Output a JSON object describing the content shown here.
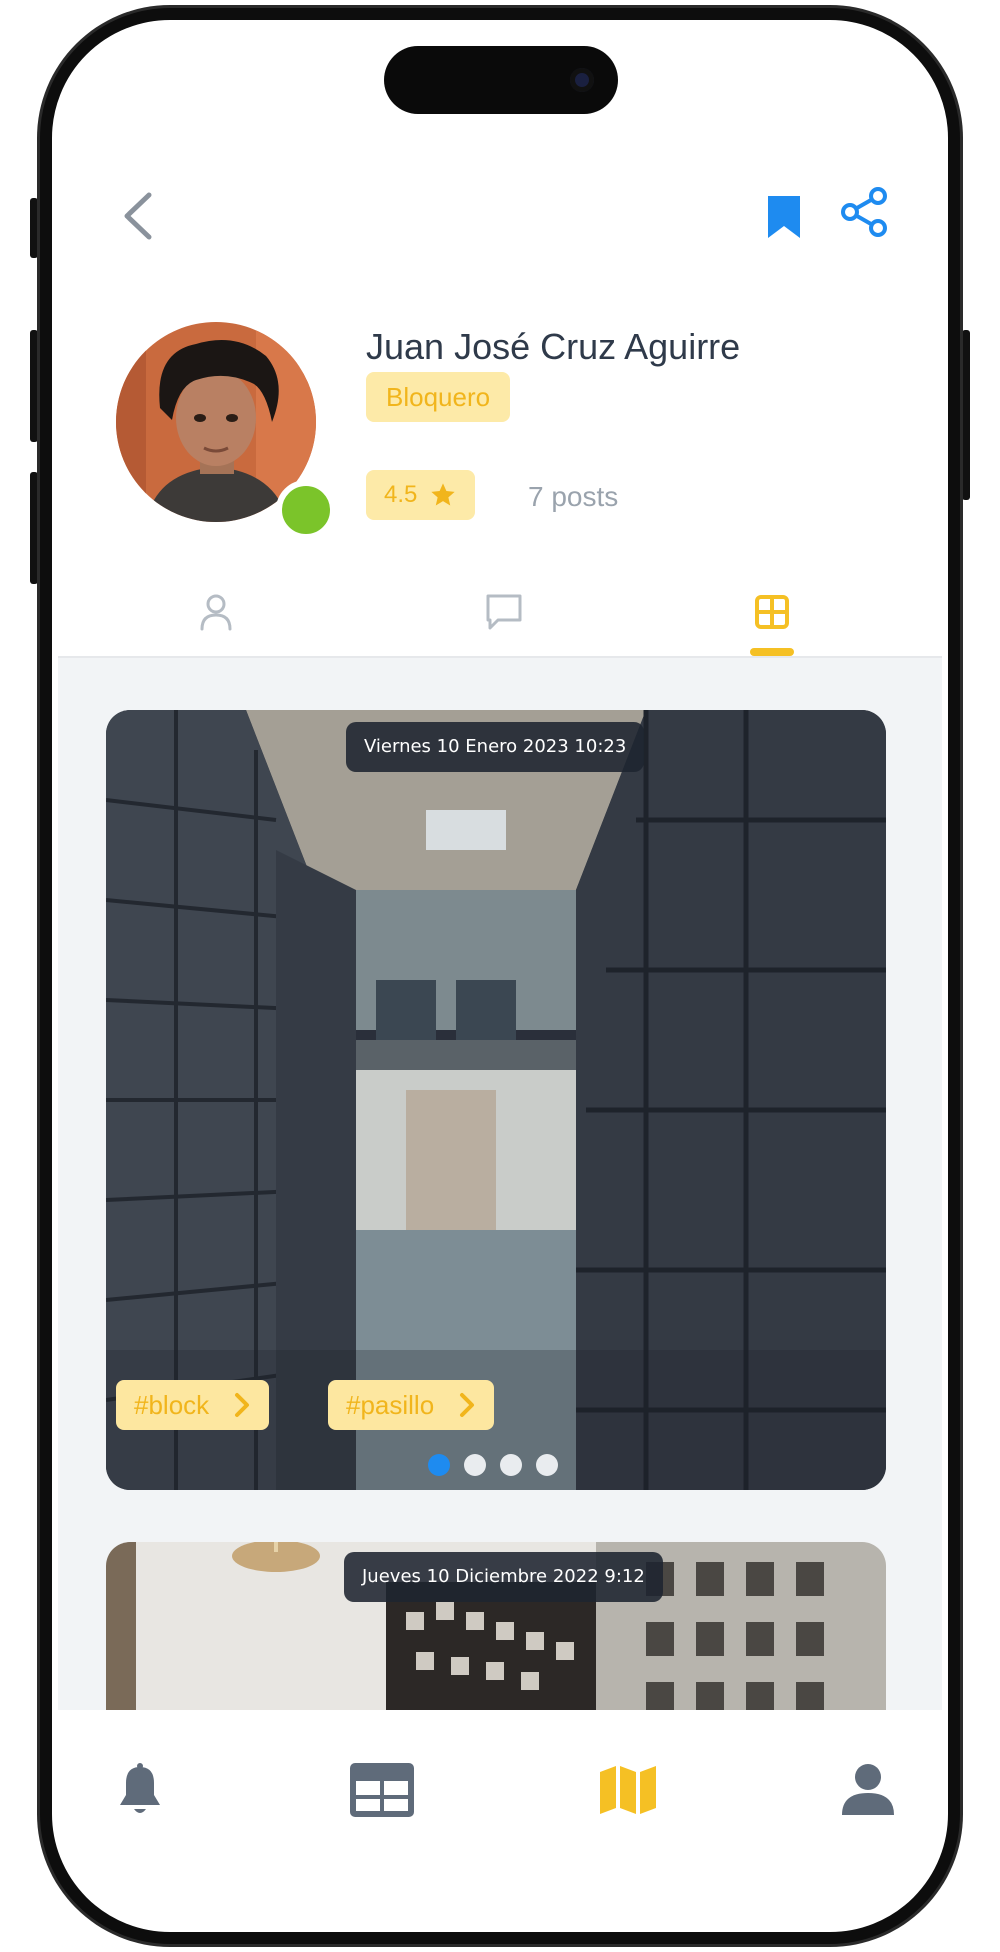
{
  "profile": {
    "name": "Juan José Cruz Aguirre",
    "role": "Bloquero",
    "rating": "4.5",
    "posts": "7 posts",
    "online": true
  },
  "tabs": [
    {
      "id": "profile",
      "icon": "person-icon",
      "active": false
    },
    {
      "id": "comments",
      "icon": "chat-bubble-icon",
      "active": false
    },
    {
      "id": "grid",
      "icon": "grid-icon",
      "active": true
    }
  ],
  "posts": [
    {
      "date": "Viernes 10 Enero 2023 10:23",
      "tags": [
        "#block",
        "#pasillo"
      ],
      "carousel_count": 4,
      "carousel_active": 1
    },
    {
      "date": "Jueves 10 Diciembre 2022 9:12"
    }
  ],
  "bottom_nav": [
    {
      "id": "notifications",
      "icon": "bell-icon",
      "active": false
    },
    {
      "id": "feed",
      "icon": "layout-grid-icon",
      "active": false
    },
    {
      "id": "map",
      "icon": "map-icon",
      "active": true
    },
    {
      "id": "account",
      "icon": "user-icon",
      "active": false
    }
  ],
  "colors": {
    "accent": "#f5c024",
    "badge_bg": "#fdeaa8",
    "blue": "#1e8bf0",
    "online": "#7bc42a",
    "nav_gray": "#5f6b7a"
  }
}
